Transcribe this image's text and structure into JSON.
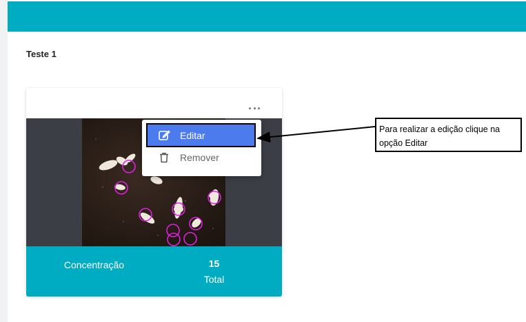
{
  "header": {
    "color": "#00acc1"
  },
  "section": {
    "title": "Teste 1"
  },
  "card": {
    "menu_icon": "more-horizontal-icon",
    "stats": {
      "label": "Concentração",
      "value": "15",
      "sub_label": "Total"
    },
    "footer_color": "#00acc1"
  },
  "dropdown": {
    "items": [
      {
        "label": "Editar",
        "icon": "edit-icon",
        "highlighted": true
      },
      {
        "label": "Remover",
        "icon": "trash-icon",
        "highlighted": false
      }
    ]
  },
  "callout": {
    "text": "Para realizar a edição clique na opção Editar"
  },
  "colors": {
    "accent": "#00acc1",
    "menu_highlight": "#4b7bec",
    "detection_circle": "#e020e0"
  }
}
